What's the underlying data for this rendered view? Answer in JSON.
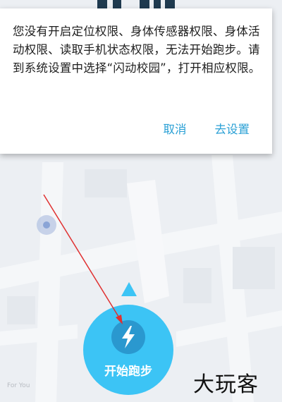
{
  "dialog": {
    "message": "您没有开启定位权限、身体传感器权限、身体活动权限、读取手机状态权限，无法开始跑步。请到系统设置中选择“闪动校园”，打开相应权限。",
    "cancel_label": "取消",
    "settings_label": "去设置"
  },
  "run": {
    "start_label": "开始跑步"
  },
  "map": {
    "caption": "For You"
  },
  "watermark": {
    "text": "大玩客"
  },
  "colors": {
    "accent": "#2aa0d5",
    "start_button": "#3cc4f5",
    "annotation_arrow": "#e03030"
  },
  "icons": {
    "start_icon": "lightning-bolt-icon",
    "direction_icon": "triangle-up-icon",
    "location_icon": "location-dot-icon"
  }
}
